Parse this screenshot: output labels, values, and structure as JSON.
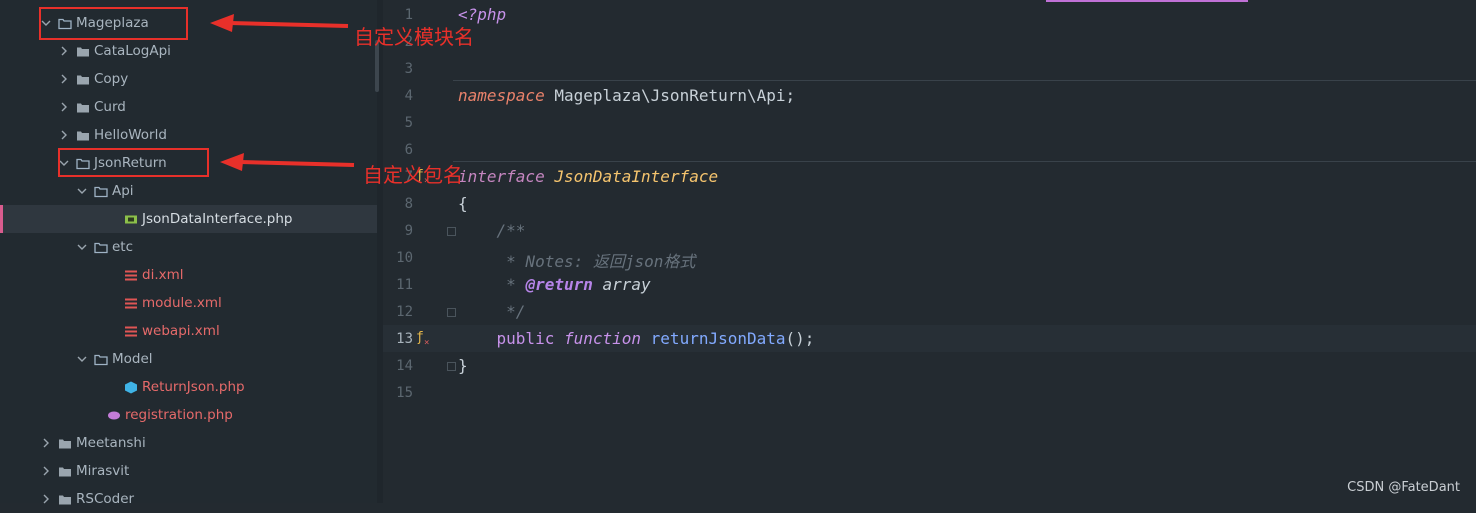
{
  "tree": {
    "items": [
      {
        "label": "Mageplaza",
        "type": "folder-open"
      },
      {
        "label": "CataLogApi",
        "type": "folder"
      },
      {
        "label": "Copy",
        "type": "folder"
      },
      {
        "label": "Curd",
        "type": "folder"
      },
      {
        "label": "HelloWorld",
        "type": "folder"
      },
      {
        "label": "JsonReturn",
        "type": "folder-open"
      },
      {
        "label": "Api",
        "type": "folder-open"
      },
      {
        "label": "JsonDataInterface.php",
        "type": "interface-file"
      },
      {
        "label": "etc",
        "type": "folder-open"
      },
      {
        "label": "di.xml",
        "type": "xml-file"
      },
      {
        "label": "module.xml",
        "type": "xml-file"
      },
      {
        "label": "webapi.xml",
        "type": "xml-file"
      },
      {
        "label": "Model",
        "type": "folder-open"
      },
      {
        "label": "ReturnJson.php",
        "type": "class-file"
      },
      {
        "label": "registration.php",
        "type": "php-file"
      },
      {
        "label": "Meetanshi",
        "type": "folder"
      },
      {
        "label": "Mirasvit",
        "type": "folder"
      },
      {
        "label": "RSCoder",
        "type": "folder"
      }
    ]
  },
  "annotations": {
    "module_name": "自定义模块名",
    "package_name": "自定义包名",
    "color": "#e8302a"
  },
  "editor": {
    "line_numbers": [
      "1",
      "2",
      "3",
      "4",
      "5",
      "6",
      "7",
      "8",
      "9",
      "10",
      "11",
      "12",
      "13",
      "14",
      "15"
    ],
    "lines": {
      "l1": "<?php",
      "l4_kw": "namespace",
      "l4_rest": " Mageplaza\\JsonReturn\\Api;",
      "l7_kw": "interface",
      "l7_name": "JsonDataInterface",
      "l8": "{",
      "l9": "    /**",
      "l10": "     * Notes: 返回json格式",
      "l11_star": "     * ",
      "l11_tag": "@return",
      "l11_type": " array",
      "l12": "     */",
      "l13_public": "    public",
      "l13_function": " function",
      "l13_name": " returnJsonData",
      "l13_rest": "();",
      "l14": "}"
    },
    "gutter_icon": "implement-icon"
  },
  "watermark": "CSDN @FateDant"
}
